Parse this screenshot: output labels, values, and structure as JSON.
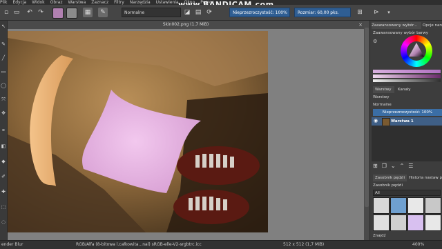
{
  "menu": [
    "Plik",
    "Edycja",
    "Widok",
    "Obraz",
    "Warstwa",
    "Zaznacz",
    "Filtry",
    "Narzędzia",
    "Ustawienia",
    "Okno",
    "Pomoc"
  ],
  "watermark": "www.BANDICAM.com",
  "toolbar": {
    "blend_mode": "Normalne",
    "opacity_label": "Nieprzezroczystość:",
    "opacity_value": "100%",
    "size_label": "Rozmiar:",
    "size_value": "60,00 pks."
  },
  "document": {
    "tab_title": "Skin002.png (1,7 MiB)"
  },
  "docker": {
    "color_tab_1": "Zaawansowany wybór...",
    "color_tab_2": "Opcje narz...",
    "color_panel_title": "Zaawansowany wybór barwy",
    "layers_tab": "Warstwy",
    "channels_tab": "Kanały",
    "layers_title": "Warstwy",
    "blend_mode": "Normalne",
    "opacity_text": "Nieprzezroczystość: 100%",
    "layer_name": "Warstwa 1",
    "brush_tab_1": "Zasobnik pędzli",
    "brush_tab_2": "Historia nastaw pędzli",
    "brush_panel_title": "Zasobnik pędzli",
    "brush_filter": "All",
    "brush_search": "Znajdź"
  },
  "status": {
    "brush_name": "ender Blur",
    "color_info": "RGB/Alfa (8-bitowa l.całkowita...nal)  sRGB-elle-V2-srgbtrc.icc",
    "image_size": "512 x 512 (1,7 MiB)",
    "zoom": "400%"
  },
  "colors": {
    "accent": "#3b6ea5",
    "layer_selected": "#3f5f86",
    "toolbar": "#454545"
  }
}
